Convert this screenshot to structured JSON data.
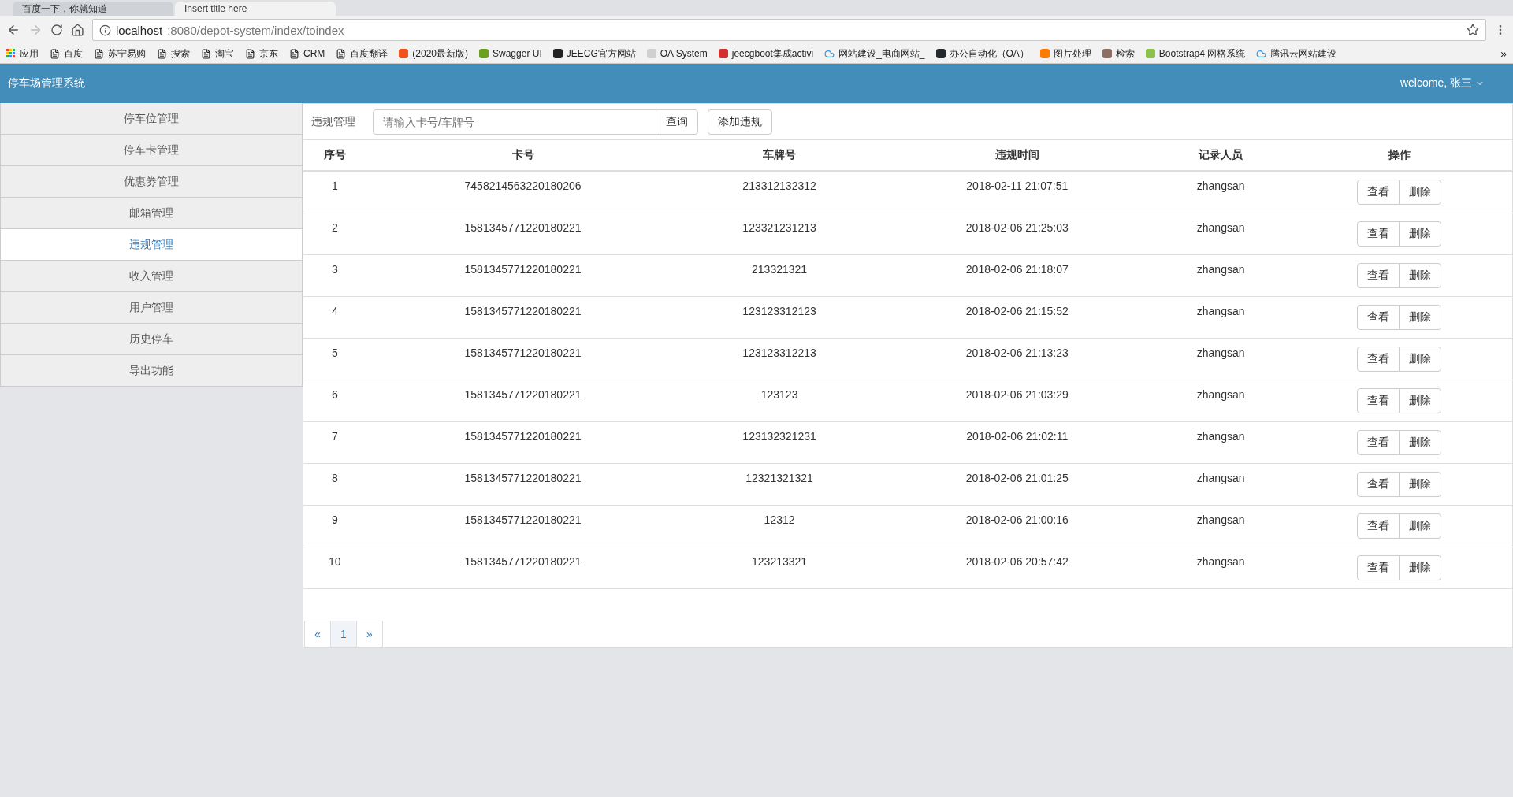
{
  "browser": {
    "tabs": [
      {
        "title": "百度一下，你就知道",
        "selected": false
      },
      {
        "title": "Insert title here",
        "selected": true
      }
    ],
    "address": {
      "host": "localhost",
      "rest": ":8080/depot-system/index/toindex"
    },
    "bookmarks": [
      {
        "label": "应用",
        "kind": "apps"
      },
      {
        "label": "百度",
        "kind": "page"
      },
      {
        "label": "苏宁易购",
        "kind": "page"
      },
      {
        "label": "搜索",
        "kind": "page"
      },
      {
        "label": "淘宝",
        "kind": "page"
      },
      {
        "label": "京东",
        "kind": "page"
      },
      {
        "label": "CRM",
        "kind": "page"
      },
      {
        "label": "百度翻译",
        "kind": "page"
      },
      {
        "label": "(2020最新版)",
        "kind": "site",
        "color": "#f4511e"
      },
      {
        "label": "Swagger UI",
        "kind": "site",
        "color": "#6a9f1f"
      },
      {
        "label": "JEECG官方网站",
        "kind": "site",
        "color": "#222222"
      },
      {
        "label": "OA System",
        "kind": "site",
        "color": "#d0d0d0"
      },
      {
        "label": "jeecgboot集成activi",
        "kind": "site",
        "color": "#d32f2f"
      },
      {
        "label": "网站建设_电商网站_",
        "kind": "cloud"
      },
      {
        "label": "办公自动化（OA）",
        "kind": "site",
        "color": "#24292e"
      },
      {
        "label": "图片处理",
        "kind": "site",
        "color": "#ff7a00"
      },
      {
        "label": "检索",
        "kind": "site",
        "color": "#8d6e63"
      },
      {
        "label": "Bootstrap4 网格系统",
        "kind": "site",
        "color": "#8bc34a"
      },
      {
        "label": "腾讯云网站建设",
        "kind": "cloud"
      }
    ],
    "more": "»"
  },
  "header": {
    "title": "停车场管理系统",
    "user": "welcome, 张三"
  },
  "sidebar": {
    "items": [
      {
        "label": "停车位管理",
        "selected": false
      },
      {
        "label": "停车卡管理",
        "selected": false
      },
      {
        "label": "优惠劵管理",
        "selected": false
      },
      {
        "label": "邮箱管理",
        "selected": false
      },
      {
        "label": "违规管理",
        "selected": true
      },
      {
        "label": "收入管理",
        "selected": false
      },
      {
        "label": "用户管理",
        "selected": false
      },
      {
        "label": "历史停车",
        "selected": false
      },
      {
        "label": "导出功能",
        "selected": false
      }
    ]
  },
  "toolbar": {
    "label": "违规管理",
    "search_placeholder": "请输入卡号/车牌号",
    "search_button": "查询",
    "add_button": "添加违规"
  },
  "table": {
    "columns": [
      "序号",
      "卡号",
      "车牌号",
      "违规时间",
      "记录人员",
      "操作"
    ],
    "rows": [
      {
        "no": "1",
        "card": "7458214563220180206",
        "plate": "213312132312",
        "time": "2018-02-11 21:07:51",
        "recorder": "zhangsan",
        "actions": [
          "查看",
          "删除"
        ]
      },
      {
        "no": "2",
        "card": "1581345771220180221",
        "plate": "123321231213",
        "time": "2018-02-06 21:25:03",
        "recorder": "zhangsan",
        "actions": [
          "查看",
          "删除"
        ]
      },
      {
        "no": "3",
        "card": "1581345771220180221",
        "plate": "213321321",
        "time": "2018-02-06 21:18:07",
        "recorder": "zhangsan",
        "actions": [
          "查看",
          "删除"
        ]
      },
      {
        "no": "4",
        "card": "1581345771220180221",
        "plate": "123123312123",
        "time": "2018-02-06 21:15:52",
        "recorder": "zhangsan",
        "actions": [
          "查看",
          "删除"
        ]
      },
      {
        "no": "5",
        "card": "1581345771220180221",
        "plate": "123123312213",
        "time": "2018-02-06 21:13:23",
        "recorder": "zhangsan",
        "actions": [
          "查看",
          "删除"
        ]
      },
      {
        "no": "6",
        "card": "1581345771220180221",
        "plate": "123123",
        "time": "2018-02-06 21:03:29",
        "recorder": "zhangsan",
        "actions": [
          "查看",
          "删除"
        ]
      },
      {
        "no": "7",
        "card": "1581345771220180221",
        "plate": "123132321231",
        "time": "2018-02-06 21:02:11",
        "recorder": "zhangsan",
        "actions": [
          "查看",
          "删除"
        ]
      },
      {
        "no": "8",
        "card": "1581345771220180221",
        "plate": "12321321321",
        "time": "2018-02-06 21:01:25",
        "recorder": "zhangsan",
        "actions": [
          "查看",
          "删除"
        ]
      },
      {
        "no": "9",
        "card": "1581345771220180221",
        "plate": "12312",
        "time": "2018-02-06 21:00:16",
        "recorder": "zhangsan",
        "actions": [
          "查看",
          "删除"
        ]
      },
      {
        "no": "10",
        "card": "1581345771220180221",
        "plate": "123213321",
        "time": "2018-02-06 20:57:42",
        "recorder": "zhangsan",
        "actions": [
          "查看",
          "删除"
        ]
      }
    ]
  },
  "pagination": [
    {
      "label": "«",
      "selected": false
    },
    {
      "label": "1",
      "selected": true
    },
    {
      "label": "»",
      "selected": false
    }
  ]
}
